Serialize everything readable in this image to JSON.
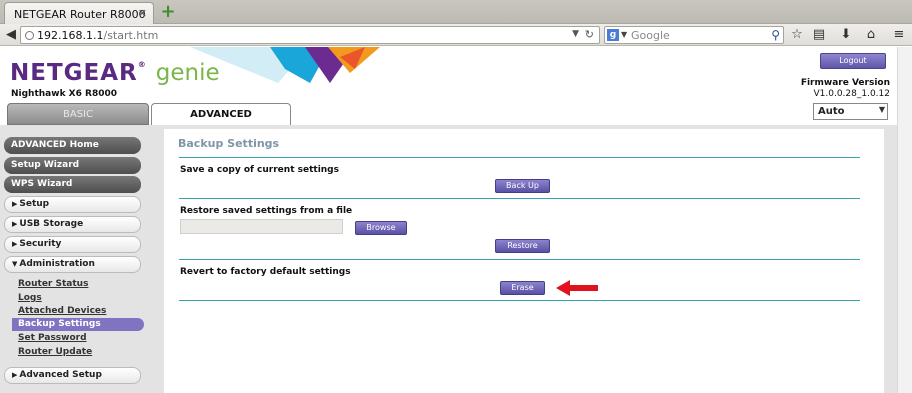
{
  "browser": {
    "tab_title": "NETGEAR Router R8000",
    "tab_close": "✕",
    "new_tab": "+",
    "url_host": "192.168.1.1",
    "url_path": "/start.htm",
    "search_placeholder": "Google",
    "search_engine_glyph": "g"
  },
  "header": {
    "logo_main": "NETGEAR",
    "logo_genie": "genie",
    "logo_reg": "®",
    "model": "Nighthawk X6 R8000",
    "logout_label": "Logout",
    "firmware_title": "Firmware Version",
    "firmware_value": "V1.0.0.28_1.0.12",
    "language_selected": "Auto"
  },
  "tabs": {
    "basic": "BASIC",
    "advanced": "ADVANCED"
  },
  "sidebar": {
    "advanced_home": "ADVANCED Home",
    "setup_wizard": "Setup Wizard",
    "wps_wizard": "WPS Wizard",
    "setup": "Setup",
    "usb_storage": "USB Storage",
    "security": "Security",
    "administration": "Administration",
    "admin_items": {
      "router_status": "Router Status",
      "logs": "Logs",
      "attached_devices": "Attached Devices",
      "backup_settings": "Backup Settings",
      "set_password": "Set Password",
      "router_update": "Router Update"
    },
    "advanced_setup": "Advanced Setup"
  },
  "main": {
    "title": "Backup Settings",
    "save_label": "Save a copy of current settings",
    "backup_button": "Back Up",
    "restore_label": "Restore saved settings from a file",
    "browse_button": "Browse",
    "restore_button": "Restore",
    "revert_label": "Revert to factory default settings",
    "erase_button": "Erase"
  },
  "colors": {
    "brand_purple": "#5a2a82",
    "genie_green": "#7ab648",
    "button_purple": "#6e65b8",
    "rule_teal": "#3aa0b4",
    "arrow_red": "#e0121b"
  }
}
